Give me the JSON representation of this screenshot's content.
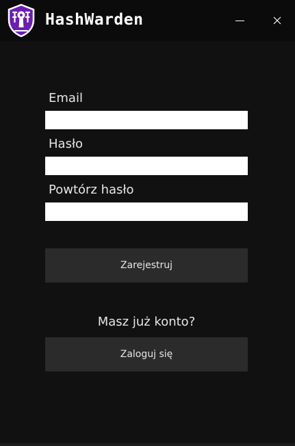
{
  "window": {
    "title": "HashWarden",
    "logo_icon": "shield-keyhole-icon",
    "minimize_icon": "minimize-icon",
    "close_icon": "close-icon",
    "close_glyph": "✕"
  },
  "form": {
    "email_label": "Email",
    "email_value": "",
    "password_label": "Hasło",
    "password_value": "",
    "repeat_password_label": "Powtórz hasło",
    "repeat_password_value": "",
    "register_label": "Zarejestruj"
  },
  "login": {
    "prompt": "Masz już konto?",
    "button_label": "Zaloguj się"
  },
  "colors": {
    "background": "#111111",
    "titlebar": "#0b0b0b",
    "button": "#2b2b2b",
    "logo_purple": "#6a1fb0",
    "text": "#e6e6e6"
  }
}
